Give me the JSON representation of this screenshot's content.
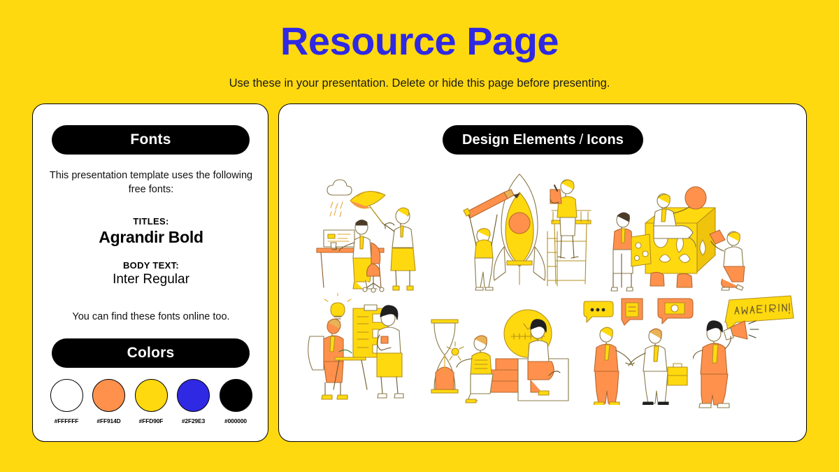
{
  "header": {
    "title": "Resource Page",
    "subtitle": "Use these in your presentation. Delete or hide this page before presenting.",
    "title_color": "#2F29E3",
    "background_color": "#FFD90F"
  },
  "fonts_card": {
    "heading": "Fonts",
    "intro": "This presentation template uses the following free fonts:",
    "titles_label": "TITLES:",
    "titles_value": "Agrandir Bold",
    "body_label": "BODY TEXT:",
    "body_value": "Inter Regular",
    "outro": "You can find these fonts online too."
  },
  "colors_card": {
    "heading": "Colors",
    "swatches": [
      {
        "hex": "#FFFFFF",
        "label": "#FFFFFF",
        "name": "swatch-white"
      },
      {
        "hex": "#FF914D",
        "label": "#FF914D",
        "name": "swatch-orange"
      },
      {
        "hex": "#FFD90F",
        "label": "#FFD90F",
        "name": "swatch-yellow"
      },
      {
        "hex": "#2F29E3",
        "label": "#2F29E3",
        "name": "swatch-blue"
      },
      {
        "hex": "#000000",
        "label": "#000000",
        "name": "swatch-black"
      }
    ]
  },
  "design_card": {
    "heading_main": "Design Elements",
    "heading_slash": "/",
    "heading_sub": "Icons",
    "illustrations": [
      {
        "name": "illustration-desk-umbrella-rain",
        "alt": "Person working at desk while colleague holds umbrella over a rain cloud"
      },
      {
        "name": "illustration-rocket-launch-build",
        "alt": "Two people building a yellow rocket with a pencil and scaffolding ladder"
      },
      {
        "name": "illustration-cube-assembly",
        "alt": "Three people assembling a large yellow cube with cut-out shapes"
      },
      {
        "name": "illustration-interview-checklist",
        "alt": "Seated person with lightbulb idea beside a clipboard checklist and interviewer"
      },
      {
        "name": "illustration-hourglass-time-steps",
        "alt": "People sitting on steps with hourglass and large clock"
      },
      {
        "name": "illustration-handshake-deal",
        "alt": "Two people shaking hands with speech bubbles and a briefcase"
      },
      {
        "name": "illustration-we-are-hiring-megaphone",
        "alt": "Person with megaphone and speech bubble reading WE ARE HIRING!"
      }
    ],
    "hiring_bubble_text": "WE ARE HIRING!"
  }
}
